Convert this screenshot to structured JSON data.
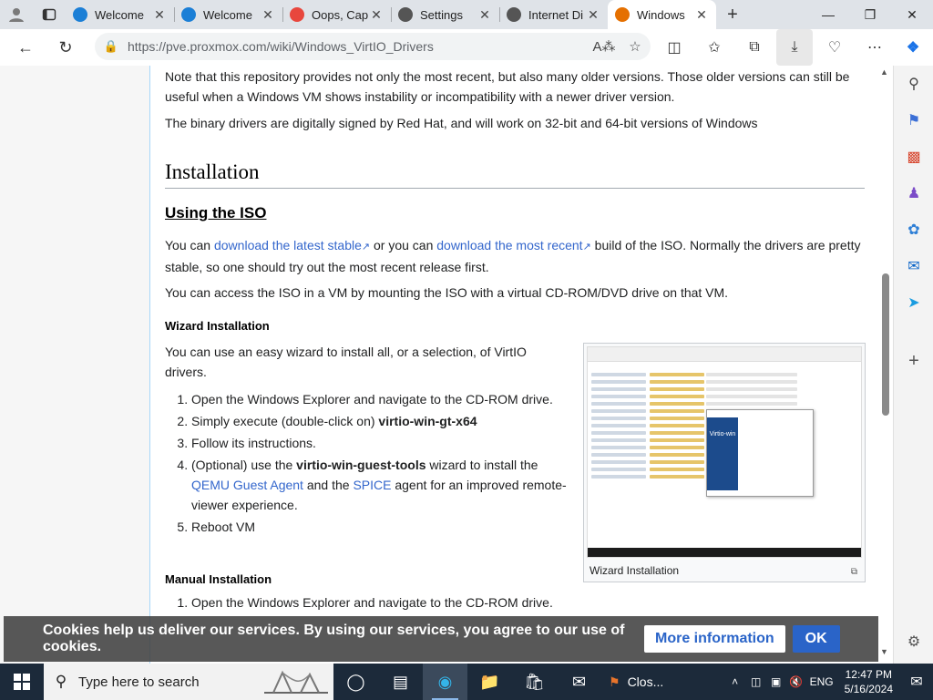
{
  "browser": {
    "tabs": [
      {
        "title": "Welcome",
        "icon": "edge-icon",
        "color": "#1b7fd6",
        "active": false
      },
      {
        "title": "Welcome",
        "icon": "edge-icon",
        "color": "#1b7fd6",
        "active": false
      },
      {
        "title": "Oops, Cap",
        "icon": "yandex-icon",
        "color": "#e8473d",
        "active": false
      },
      {
        "title": "Settings",
        "icon": "gear-icon",
        "color": "#555555",
        "active": false
      },
      {
        "title": "Internet Di",
        "icon": "page-icon",
        "color": "#555555",
        "active": false
      },
      {
        "title": "Windows",
        "icon": "proxmox-icon",
        "color": "#e57000",
        "active": true
      }
    ],
    "url": "https://pve.proxmox.com/wiki/Windows_VirtIO_Drivers"
  },
  "article": {
    "p1": "Note that this repository provides not only the most recent, but also many older versions. Those older versions can still be useful when a Windows VM shows instability or incompatibility with a newer driver version.",
    "p2": "The binary drivers are digitally signed by Red Hat, and will work on 32-bit and 64-bit versions of Windows",
    "h1": "Installation",
    "h2": "Using the ISO",
    "p3_a": "You can ",
    "p3_link1": "download the latest stable",
    "p3_b": " or you can ",
    "p3_link2": "download the most recent",
    "p3_c": " build of the ISO. Normally the drivers are pretty stable, so one should try out the most recent release first.",
    "p4": "You can access the ISO in a VM by mounting the ISO with a virtual CD-ROM/DVD drive on that VM.",
    "h3_wizard": "Wizard Installation",
    "p5": "You can use an easy wizard to install all, or a selection, of VirtIO drivers.",
    "wizard_steps": {
      "s1": "Open the Windows Explorer and navigate to the CD-ROM drive.",
      "s2_a": "Simply execute (double-click on) ",
      "s2_b": "virtio-win-gt-x64",
      "s3": "Follow its instructions.",
      "s4_a": "(Optional) use the ",
      "s4_b": "virtio-win-guest-tools",
      "s4_c": " wizard to install the ",
      "s4_link1": "QEMU Guest Agent",
      "s4_d": " and the ",
      "s4_link2": "SPICE",
      "s4_e": " agent for an improved remote-viewer experience.",
      "s5": "Reboot VM"
    },
    "figure_caption": "Wizard Installation",
    "figure_dialog_label": "Virtio-win",
    "h3_manual": "Manual Installation",
    "manual_steps": {
      "s1": "Open the Windows Explorer and navigate to the CD-ROM drive."
    }
  },
  "cookie": {
    "message": "Cookies help us deliver our services. By using our services, you agree to our use of cookies.",
    "more_label": "More information",
    "ok_label": "OK"
  },
  "taskbar": {
    "search_placeholder": "Type here to search",
    "notification_label": "Clos...",
    "language": "ENG",
    "time": "12:47 PM",
    "date": "5/16/2024"
  }
}
